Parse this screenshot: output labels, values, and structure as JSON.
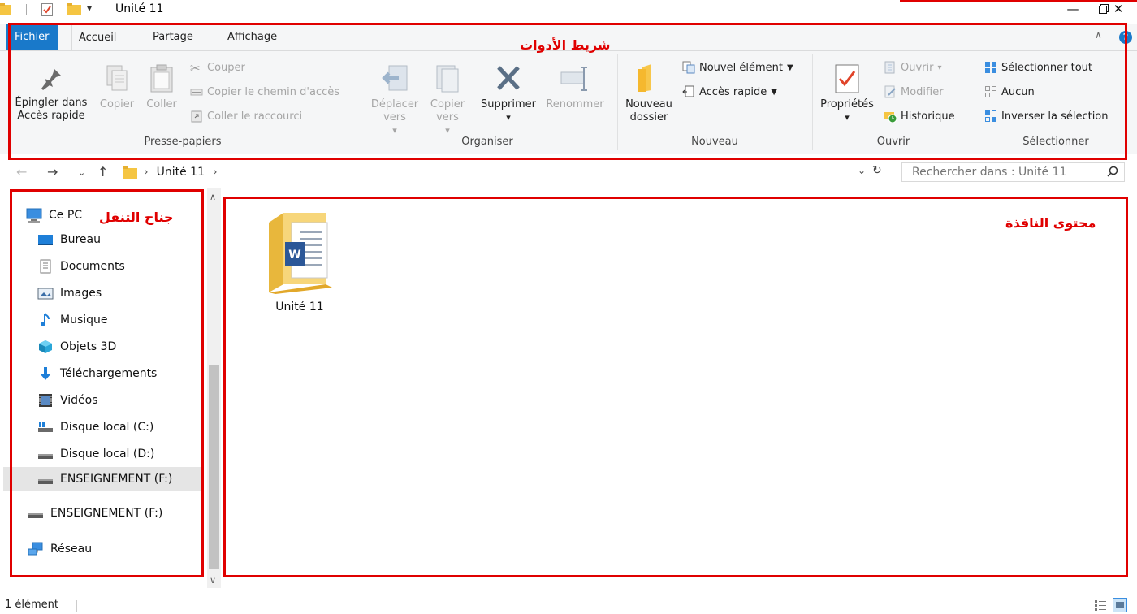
{
  "window": {
    "title": "Unité 11",
    "controls": [
      "minimize",
      "restore",
      "close"
    ]
  },
  "ribbon": {
    "tabs": [
      {
        "label": "Fichier"
      },
      {
        "label": "Accueil"
      },
      {
        "label": "Partage"
      },
      {
        "label": "Affichage"
      }
    ],
    "groups": {
      "clipboard": {
        "label": "Presse-papiers",
        "pin": "Épingler dans Accès rapide",
        "copy": "Copier",
        "paste": "Coller",
        "cut": "Couper",
        "copy_path": "Copier le chemin d'accès",
        "paste_shortcut": "Coller le raccourci"
      },
      "organize": {
        "label": "Organiser",
        "move_to": "Déplacer vers",
        "copy_to": "Copier vers",
        "delete": "Supprimer",
        "rename": "Renommer"
      },
      "new": {
        "label": "Nouveau",
        "new_folder": "Nouveau dossier",
        "new_item": "Nouvel élément",
        "easy_access": "Accès rapide"
      },
      "open": {
        "label": "Ouvrir",
        "properties": "Propriétés",
        "open": "Ouvrir",
        "edit": "Modifier",
        "history": "Historique"
      },
      "select": {
        "label": "Sélectionner",
        "select_all": "Sélectionner tout",
        "select_none": "Aucun",
        "invert": "Inverser la sélection"
      }
    }
  },
  "address": {
    "path": "Unité 11",
    "search_placeholder": "Rechercher dans : Unité 11"
  },
  "nav_pane": {
    "items": [
      {
        "label": "Ce PC",
        "icon": "computer-icon"
      },
      {
        "label": "Bureau",
        "icon": "desktop-icon"
      },
      {
        "label": "Documents",
        "icon": "documents-icon"
      },
      {
        "label": "Images",
        "icon": "images-icon"
      },
      {
        "label": "Musique",
        "icon": "music-icon"
      },
      {
        "label": "Objets 3D",
        "icon": "objects-3d-icon"
      },
      {
        "label": "Téléchargements",
        "icon": "downloads-icon"
      },
      {
        "label": "Vidéos",
        "icon": "videos-icon"
      },
      {
        "label": "Disque local (C:)",
        "icon": "system-drive-icon"
      },
      {
        "label": "Disque local (D:)",
        "icon": "drive-icon"
      },
      {
        "label": "ENSEIGNEMENT (F:)",
        "icon": "drive-icon",
        "selected": true
      },
      {
        "label": "ENSEIGNEMENT (F:)",
        "icon": "drive-icon"
      },
      {
        "label": "Réseau",
        "icon": "network-icon"
      }
    ]
  },
  "content": {
    "items": [
      {
        "name": "Unité 11",
        "icon": "word-folder-icon"
      }
    ]
  },
  "status": {
    "count": "1 élément"
  },
  "annotations": {
    "toolbar": "شريط الأدوات",
    "nav_pane": "جناح التنقل",
    "window_content": "محتوى النافذة"
  },
  "colors": {
    "annotation": "#e00000",
    "file_tab": "#1979ca",
    "ribbon_bg": "#f5f6f7"
  }
}
